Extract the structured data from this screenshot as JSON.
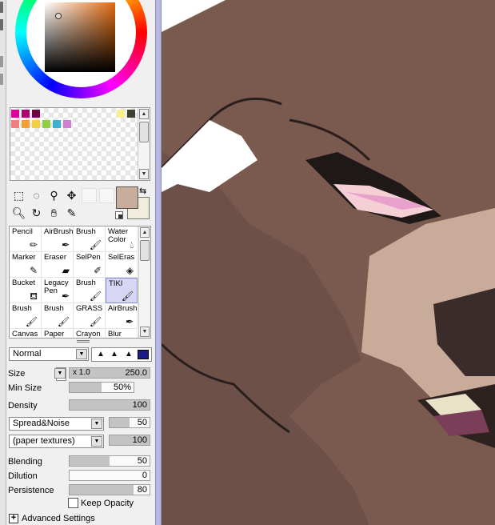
{
  "colors": {
    "current": "#c8ac9c",
    "secondary": "#f2ecdc",
    "accent": "#b8b8dc"
  },
  "icons": {
    "swap": "swap-colors-icon",
    "reset": "default-colors-icon",
    "advanced": "expand-plus-icon"
  },
  "swatches": [
    "#e000a0",
    "#b00070",
    "#700040",
    "#f8f090",
    "#404030",
    "#f08080",
    "#f0a030",
    "#f0d040",
    "#90d040",
    "#40b0d0",
    "#d080d0"
  ],
  "tools": [
    "rect-select-icon",
    "lasso-icon",
    "magic-wand-icon",
    "move-icon",
    "zoom-icon",
    "rotate-icon",
    "hand-icon",
    "eyedropper-icon"
  ],
  "brushes": [
    {
      "label": "Pencil",
      "icon": "pencil-icon"
    },
    {
      "label": "AirBrush",
      "icon": "airbrush-icon"
    },
    {
      "label": "Brush",
      "icon": "brush-icon"
    },
    {
      "label": "Water\nColor",
      "icon": "watercolor-icon"
    },
    {
      "label": "Marker",
      "icon": "marker-icon"
    },
    {
      "label": "Eraser",
      "icon": "eraser-icon"
    },
    {
      "label": "SelPen",
      "icon": "selpen-icon"
    },
    {
      "label": "SelEras",
      "icon": "selerase-icon"
    },
    {
      "label": "Bucket",
      "icon": "bucket-icon"
    },
    {
      "label": "Legacy\nPen",
      "icon": "pen-icon"
    },
    {
      "label": "Brush",
      "icon": "brush-icon"
    },
    {
      "label": "TIKI",
      "icon": "brush-icon",
      "selected": true
    },
    {
      "label": "Brush",
      "icon": "brush-icon"
    },
    {
      "label": "Brush",
      "icon": "brush-icon"
    },
    {
      "label": "GRASS",
      "icon": "brush-icon"
    },
    {
      "label": "AirBrush",
      "icon": "airbrush-icon"
    },
    {
      "label": "Canvas",
      "icon": ""
    },
    {
      "label": "Paper",
      "icon": ""
    },
    {
      "label": "Crayon",
      "icon": ""
    },
    {
      "label": "Blur",
      "icon": ""
    }
  ],
  "blend_mode": "Normal",
  "size": {
    "label": "Size",
    "multiplier": "x 1.0",
    "value": "250.0",
    "fill": 1.0
  },
  "min_size": {
    "label": "Min Size",
    "value": "50%",
    "fill": 0.5
  },
  "density": {
    "label": "Density",
    "value": "100",
    "fill": 1.0
  },
  "texture1": {
    "label": "Spread&Noise",
    "value": "50",
    "fill": 0.5
  },
  "texture2": {
    "label": "(paper textures)",
    "value": "100",
    "fill": 1.0
  },
  "blending": {
    "label": "Blending",
    "value": "50",
    "fill": 0.5
  },
  "dilution": {
    "label": "Dilution",
    "value": "0",
    "fill": 0.0
  },
  "persistence": {
    "label": "Persistence",
    "value": "80",
    "fill": 0.8
  },
  "keep_opacity": {
    "label": "Keep Opacity",
    "checked": false
  },
  "advanced": {
    "label": "Advanced Settings"
  }
}
